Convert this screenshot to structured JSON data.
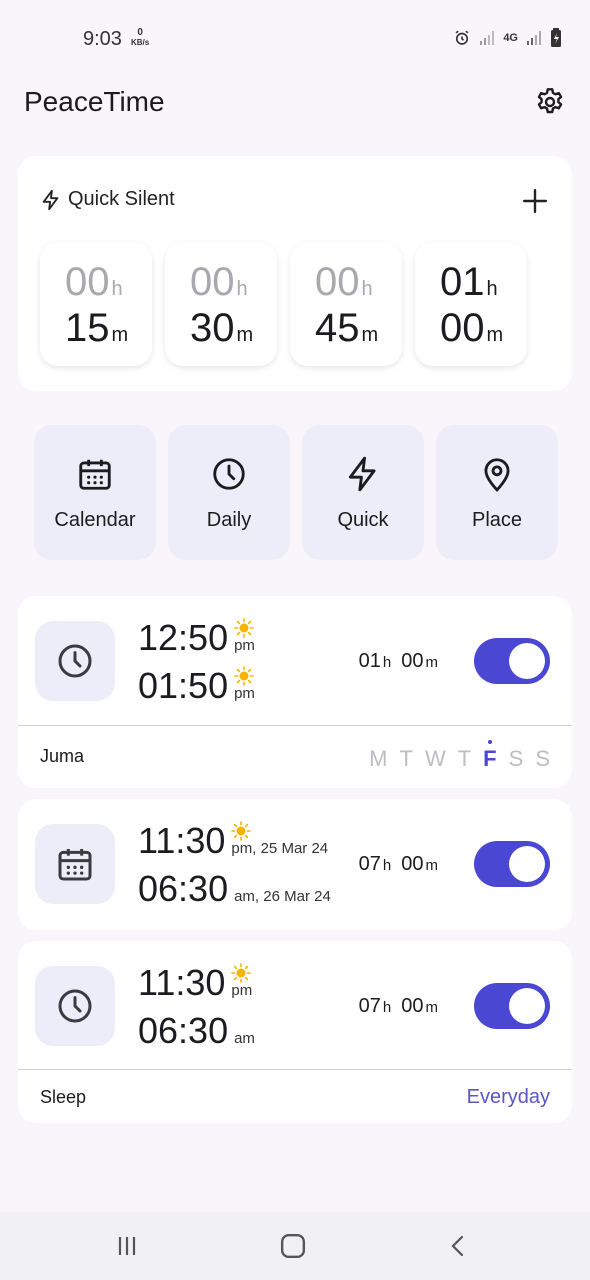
{
  "status": {
    "time": "9:03",
    "net_speed_value": "0",
    "net_speed_unit": "KB/s",
    "network_label": "4G"
  },
  "app": {
    "title": "PeaceTime"
  },
  "quick_silent": {
    "title": "Quick Silent",
    "options": [
      {
        "hours": "00",
        "hours_unit": "h",
        "minutes": "15",
        "minutes_unit": "m"
      },
      {
        "hours": "00",
        "hours_unit": "h",
        "minutes": "30",
        "minutes_unit": "m"
      },
      {
        "hours": "00",
        "hours_unit": "h",
        "minutes": "45",
        "minutes_unit": "m"
      },
      {
        "hours": "01",
        "hours_unit": "h",
        "minutes": "00",
        "minutes_unit": "m"
      }
    ]
  },
  "categories": [
    {
      "label": "Calendar",
      "icon": "calendar-icon"
    },
    {
      "label": "Daily",
      "icon": "clock-icon"
    },
    {
      "label": "Quick",
      "icon": "lightning-icon"
    },
    {
      "label": "Place",
      "icon": "location-pin-icon"
    }
  ],
  "schedules": [
    {
      "icon": "clock-icon",
      "start_time": "12:50",
      "start_suffix": "pm",
      "start_icon": "sun-icon",
      "end_time": "01:50",
      "end_suffix": "pm",
      "end_icon": "sun-icon",
      "duration_hours": "01",
      "duration_hours_unit": "h",
      "duration_minutes": "00",
      "duration_minutes_unit": "m",
      "enabled": true,
      "label": "Juma",
      "days": [
        "M",
        "T",
        "W",
        "T",
        "F",
        "S",
        "S"
      ],
      "active_day_index": 4
    },
    {
      "icon": "calendar-icon",
      "start_time": "11:30",
      "start_suffix": "pm, 25 Mar 24",
      "start_icon": "sun-icon",
      "end_time": "06:30",
      "end_suffix": "am, 26 Mar 24",
      "end_icon": "moon-icon",
      "duration_hours": "07",
      "duration_hours_unit": "h",
      "duration_minutes": "00",
      "duration_minutes_unit": "m",
      "enabled": true
    },
    {
      "icon": "clock-icon",
      "start_time": "11:30",
      "start_suffix": "pm",
      "start_icon": "sun-icon",
      "end_time": "06:30",
      "end_suffix": "am",
      "end_icon": "moon-icon",
      "duration_hours": "07",
      "duration_hours_unit": "h",
      "duration_minutes": "00",
      "duration_minutes_unit": "m",
      "enabled": true,
      "label": "Sleep",
      "repeat": "Everyday"
    }
  ],
  "colors": {
    "accent": "#4a47d3",
    "card_tint": "#ecedf8",
    "sun": "#f5b400",
    "moon": "#9e9e9e"
  }
}
